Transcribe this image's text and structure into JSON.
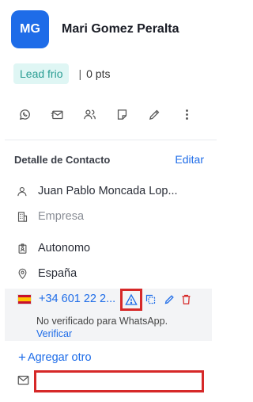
{
  "contact": {
    "initials": "MG",
    "name": "Mari Gomez Peralta",
    "status_tag": "Lead frio",
    "points_sep": "|",
    "points": "0 pts"
  },
  "actions": [
    {
      "icon": "whatsapp-icon"
    },
    {
      "icon": "email-send-icon"
    },
    {
      "icon": "users-icon"
    },
    {
      "icon": "note-icon"
    },
    {
      "icon": "pencil-icon"
    },
    {
      "icon": "more-vertical-icon"
    }
  ],
  "details": {
    "title": "Detalle de Contacto",
    "edit_label": "Editar",
    "contact_name": "Juan Pablo Moncada Lop...",
    "company_placeholder": "Empresa",
    "type": "Autonomo",
    "country": "España"
  },
  "phone": {
    "number": "+34 601 22 2...",
    "whatsapp_note": "No verificado para WhatsApp.",
    "verify_label": "Verificar"
  },
  "add_other_label": "Agregar otro",
  "email": {
    "value": "",
    "placeholder": ""
  },
  "colors": {
    "accent": "#1e6ce8",
    "tag_bg": "#dff6f4",
    "tag_text": "#2a9d93",
    "highlight": "#d62828",
    "delete": "#d62828"
  }
}
